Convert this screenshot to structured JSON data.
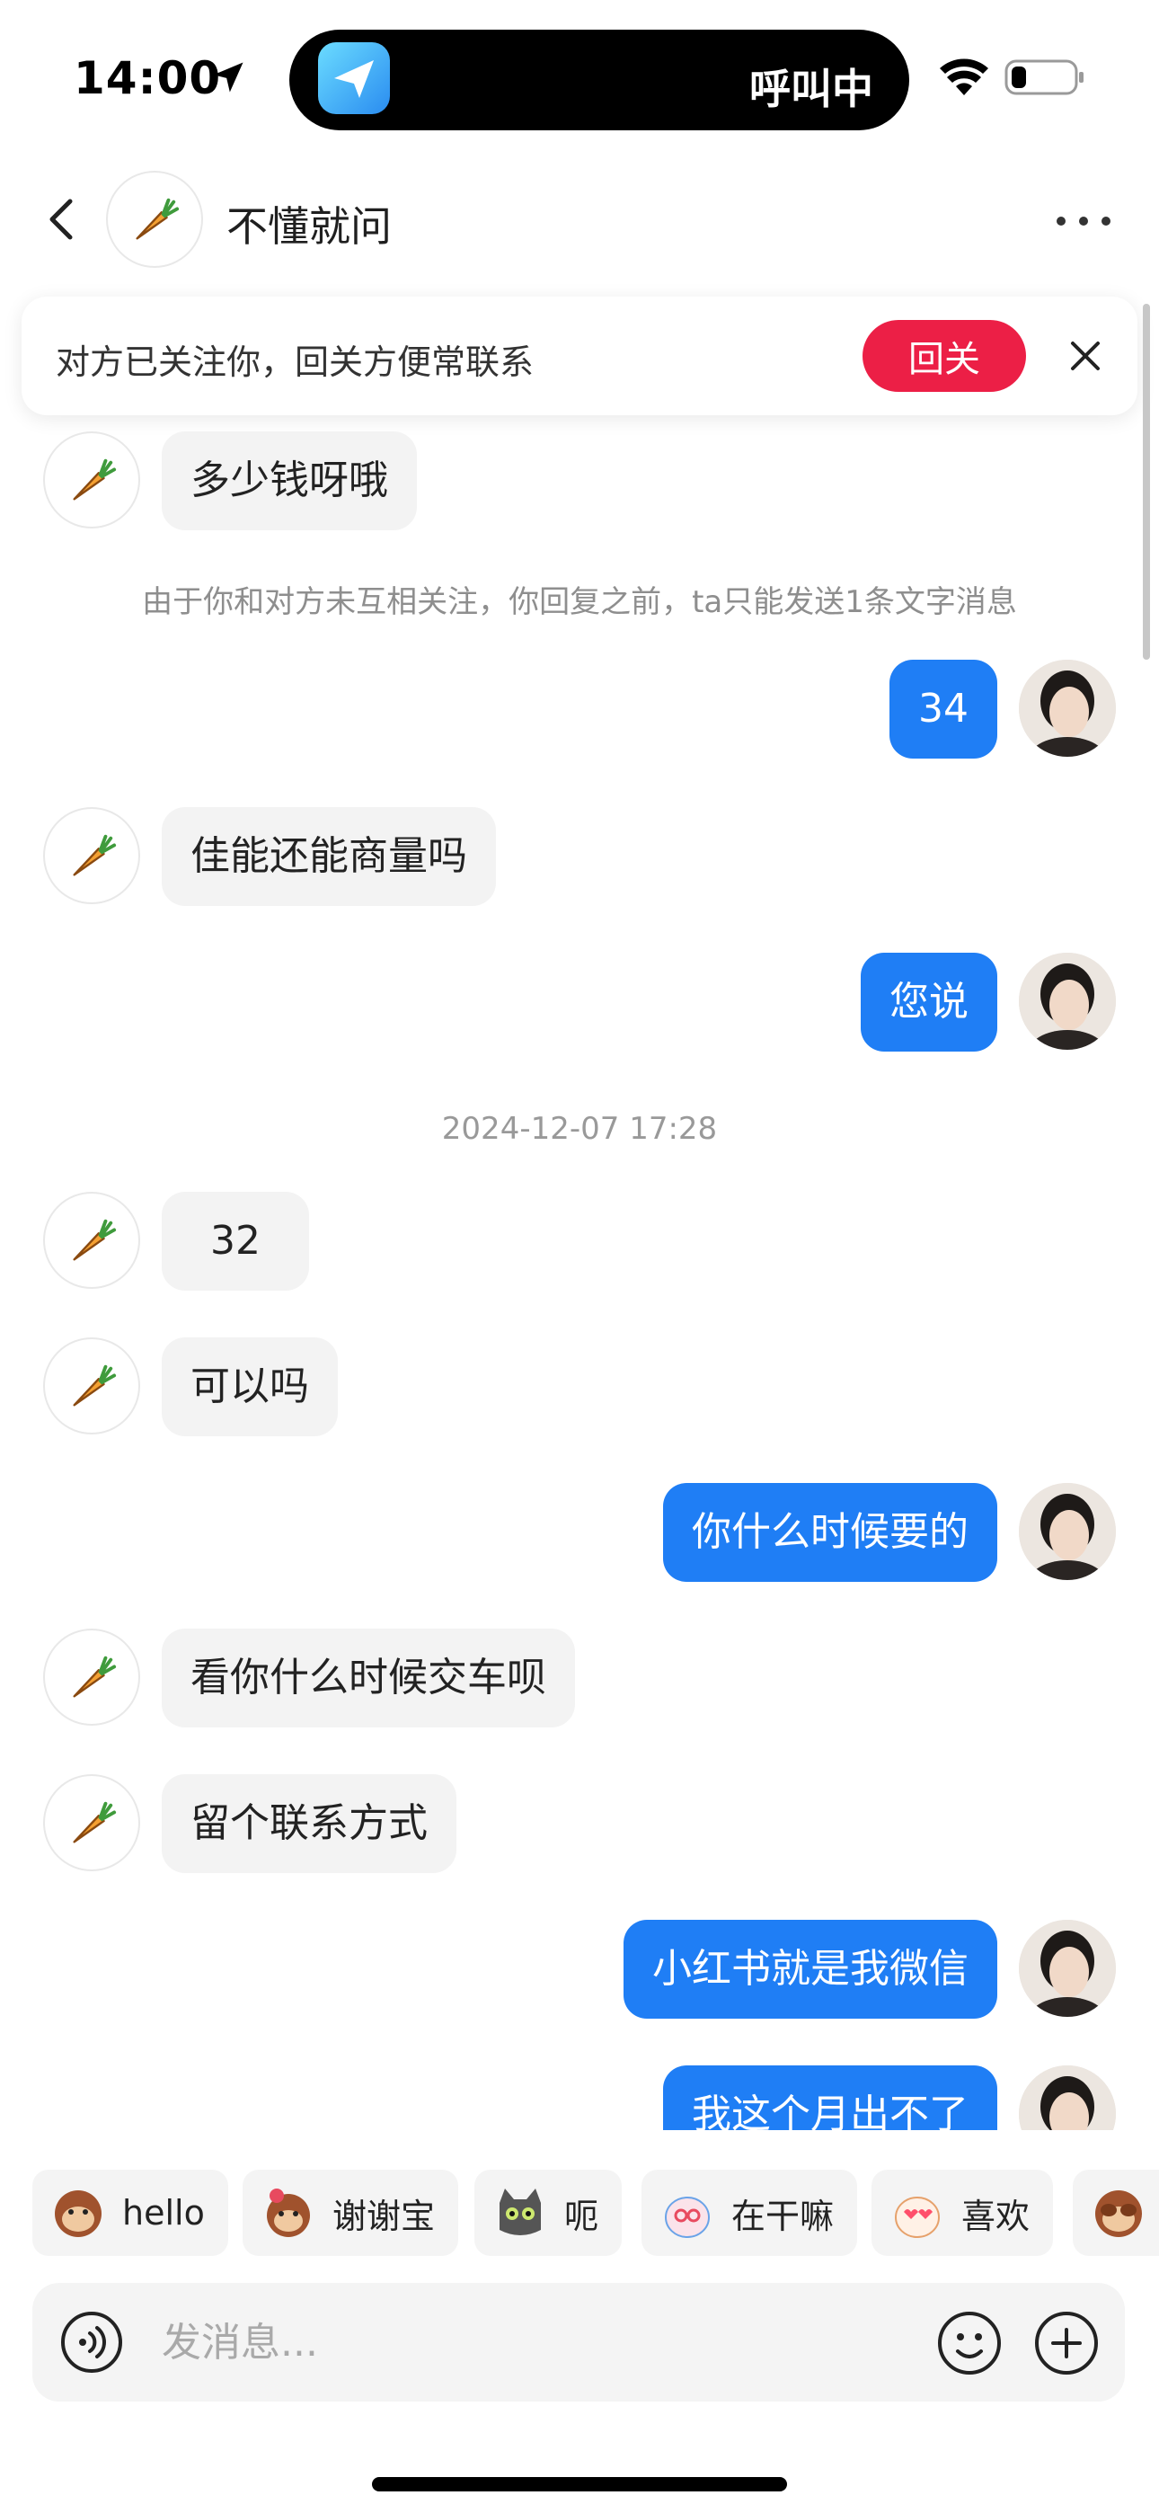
{
  "status_bar": {
    "time": "14:00",
    "island_text": "呼叫中"
  },
  "header": {
    "title": "不懂就问",
    "avatar_icon": "carrot-icon"
  },
  "follow_banner": {
    "text": "对方已关注你，回关方便常联系",
    "button_label": "回关"
  },
  "messages": {
    "m1": "多少钱呀哦",
    "notice": "由于你和对方未互相关注，你回复之前，ta只能发送1条文字消息",
    "m2": "34",
    "m3": "佳能还能商量吗",
    "m4": "您说",
    "timestamp": "2024-12-07 17:28",
    "m5": "32",
    "m6": "可以吗",
    "m7": "你什么时候要的",
    "m8": "看你什么时候交车呗",
    "m9": "留个联系方式",
    "m10": "小红书就是我微信",
    "m11": "我这个月出不了"
  },
  "stickers": [
    {
      "label": "hello",
      "icon": "monkey-sticker-icon"
    },
    {
      "label": "谢谢宝",
      "icon": "monkey-flower-sticker-icon"
    },
    {
      "label": "呃",
      "icon": "cat-sticker-icon"
    },
    {
      "label": "在干嘛",
      "icon": "bunny-sticker-icon"
    },
    {
      "label": "喜欢",
      "icon": "bunny-love-sticker-icon"
    },
    {
      "label": "",
      "icon": "monkey-cover-sticker-icon"
    }
  ],
  "input": {
    "placeholder": "发消息..."
  },
  "colors": {
    "accent_blue": "#1f7ef5",
    "follow_red": "#ec1f46",
    "bubble_gray": "#f3f3f3"
  }
}
